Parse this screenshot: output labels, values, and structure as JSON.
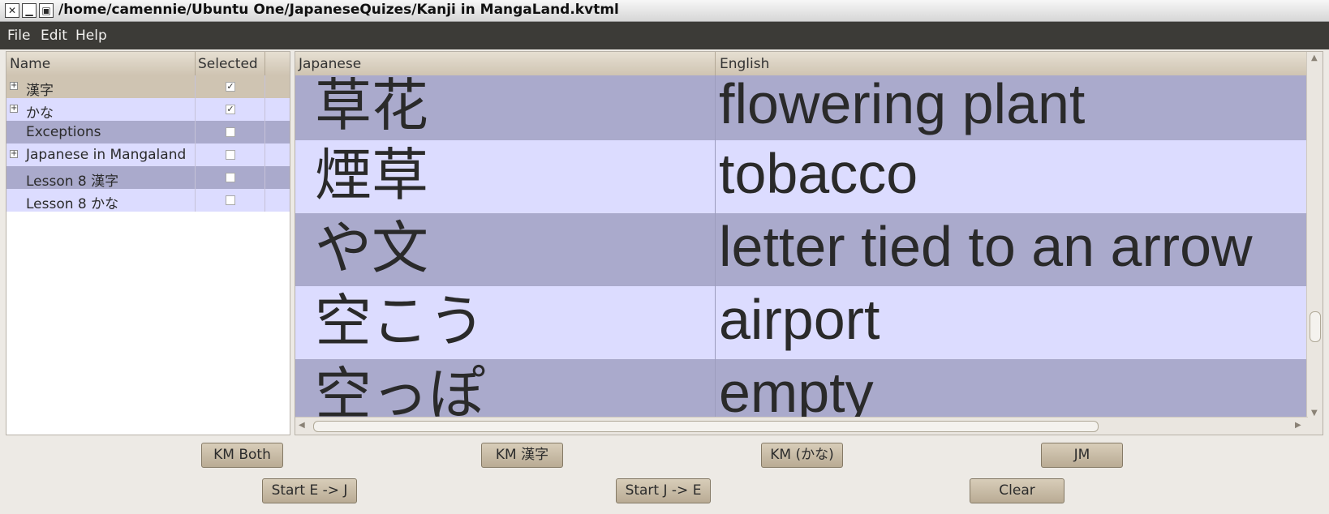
{
  "window": {
    "title": "/home/camennie/Ubuntu One/JapaneseQuizes/Kanji in MangaLand.kvtml",
    "close_glyph": "✕",
    "minimize_glyph": "▁",
    "maximize_glyph": "▣"
  },
  "menubar": {
    "items": [
      "File",
      "Edit",
      "Help"
    ]
  },
  "lesson_tree": {
    "columns": [
      "Name",
      "Selected"
    ],
    "rows": [
      {
        "name": "漢字",
        "selected": true,
        "expandable": true
      },
      {
        "name": "かな",
        "selected": true,
        "expandable": true
      },
      {
        "name": "Exceptions",
        "selected": false,
        "expandable": false
      },
      {
        "name": "Japanese in Mangaland",
        "selected": false,
        "expandable": true
      },
      {
        "name": "Lesson 8 漢字",
        "selected": false,
        "expandable": false
      },
      {
        "name": "Lesson 8 かな",
        "selected": false,
        "expandable": false
      }
    ],
    "expander_glyph": "+",
    "check_glyph": "✓"
  },
  "vocab_table": {
    "columns": [
      "Japanese",
      "English"
    ],
    "rows": [
      {
        "japanese": "草花",
        "english": "flowering plant"
      },
      {
        "japanese": "煙草",
        "english": "tobacco"
      },
      {
        "japanese": "や文",
        "english": "letter tied to an arrow"
      },
      {
        "japanese": "空こう",
        "english": "airport"
      },
      {
        "japanese": "空っぽ",
        "english": "empty"
      }
    ]
  },
  "buttons": {
    "km_both": "KM Both",
    "km_kanji": "KM 漢字",
    "km_kana": "KM (かな)",
    "jm": "JM",
    "start_e_j": "Start E -> J",
    "start_j_e": "Start J -> E",
    "clear": "Clear"
  },
  "colors": {
    "row_dark": "#aaaacc",
    "row_light": "#dcdcff",
    "row_header_selected": "#cfc4b2",
    "menubar": "#3c3b37"
  }
}
